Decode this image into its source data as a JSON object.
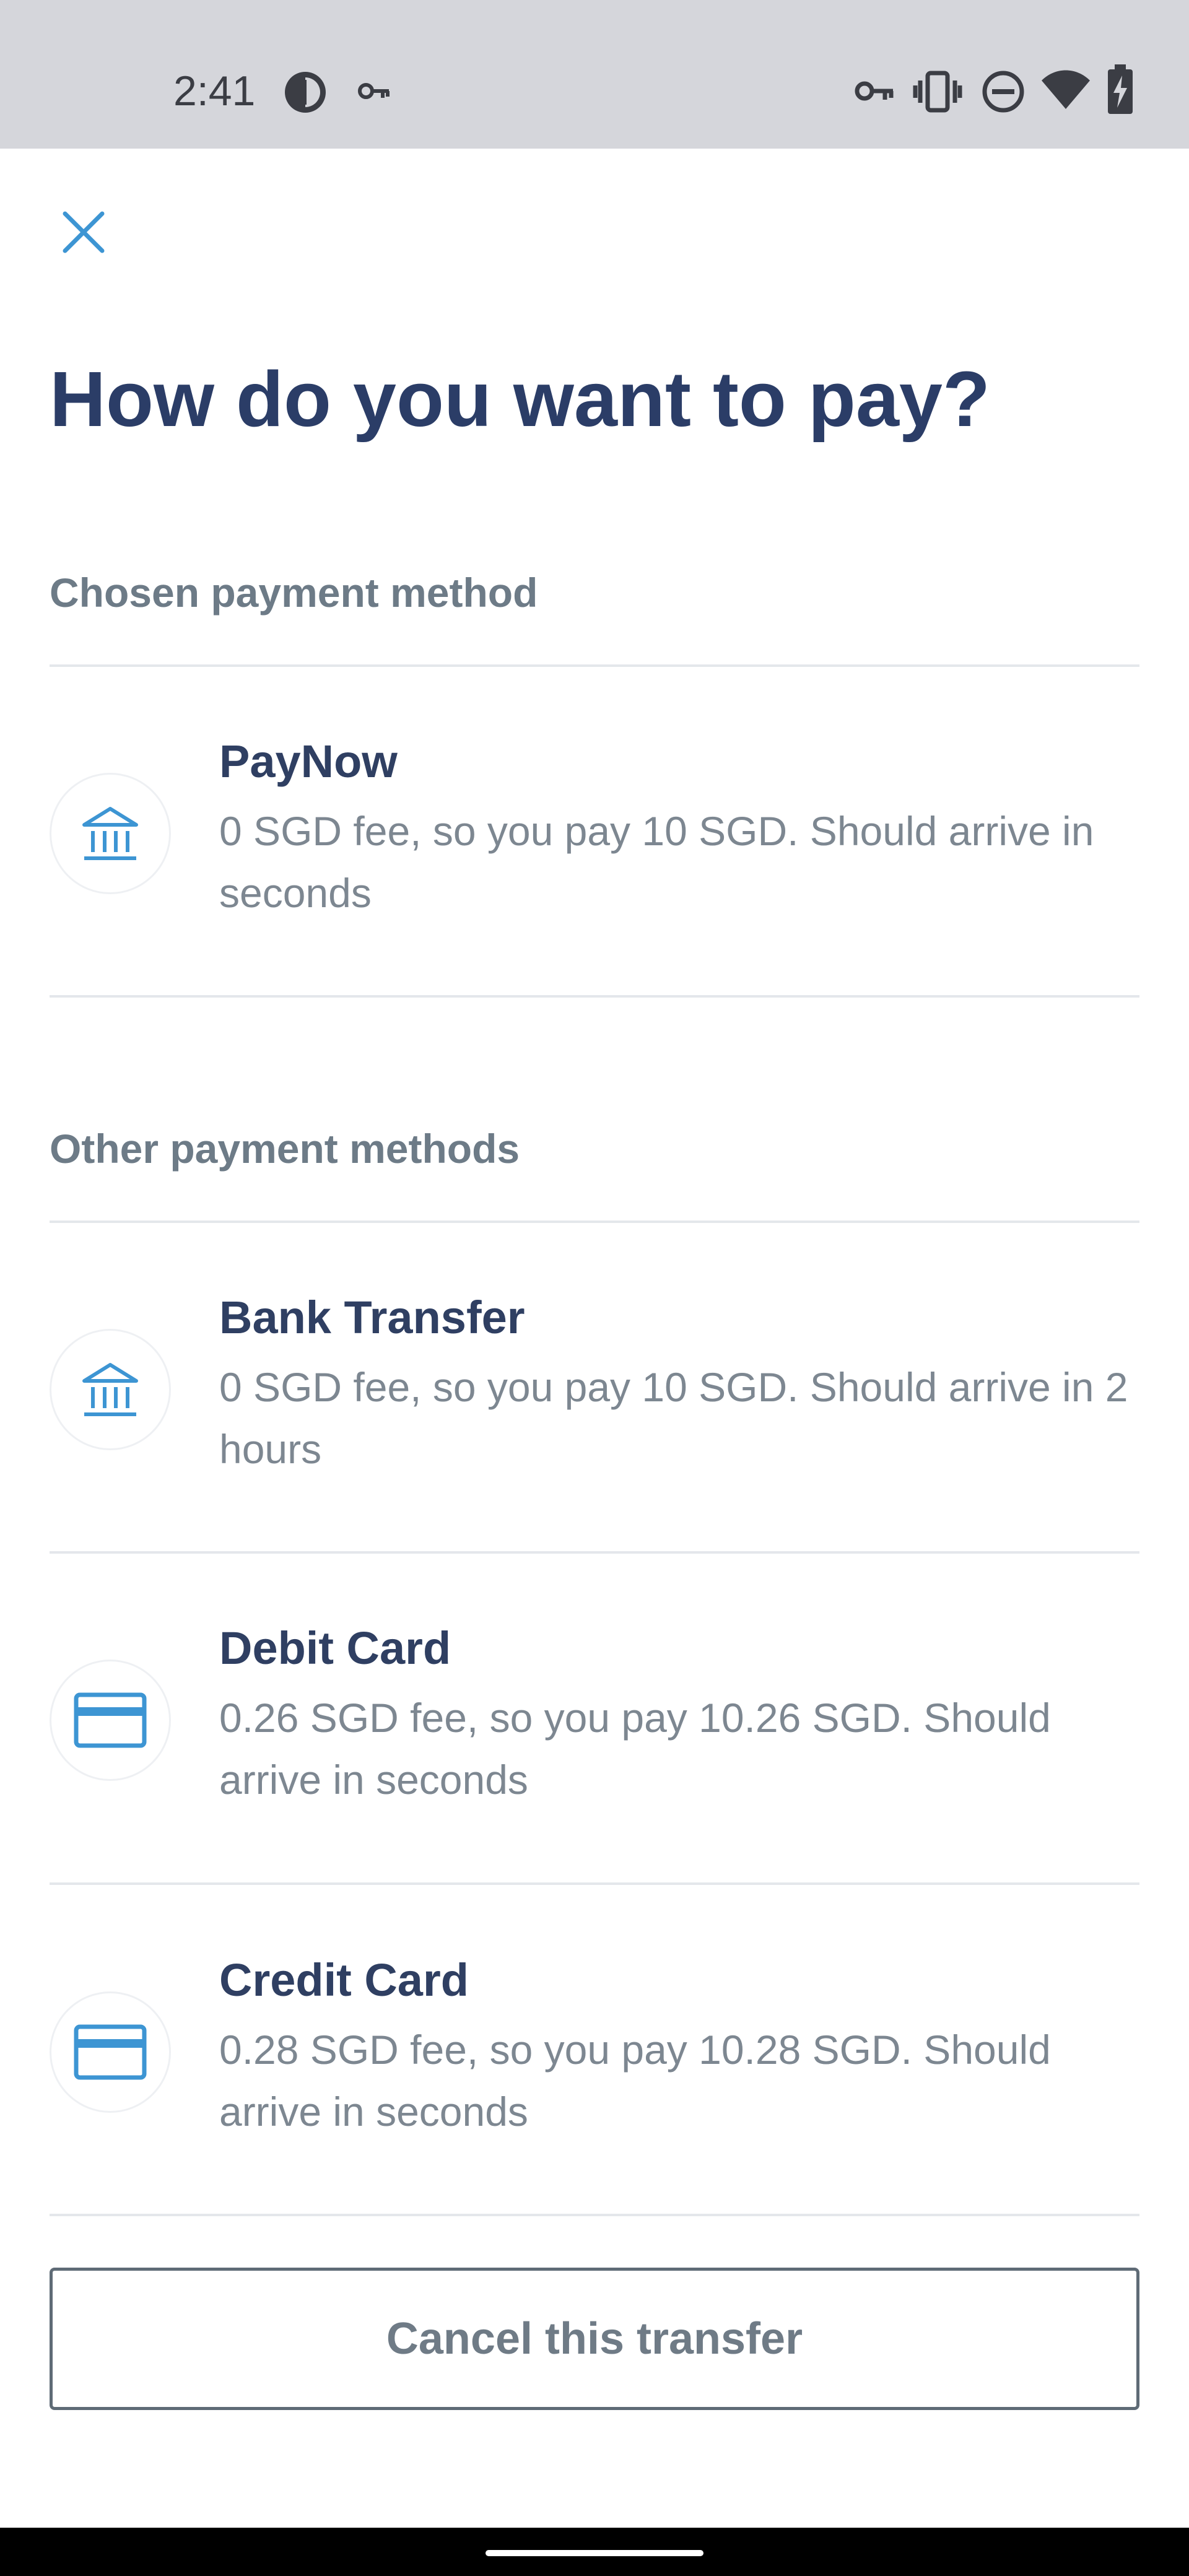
{
  "status_bar": {
    "time": "2:41",
    "left_icons": [
      "app-notification-icon",
      "vpn-key-icon"
    ],
    "right_icons": [
      "vpn-key-icon",
      "vibrate-icon",
      "do-not-disturb-icon",
      "wifi-icon",
      "battery-charging-icon"
    ]
  },
  "header": {
    "close_icon": "close-icon",
    "title": "How do you want to pay?"
  },
  "chosen_section": {
    "label": "Chosen payment method",
    "method": {
      "icon": "bank-icon",
      "title": "PayNow",
      "description": "0 SGD fee, so you pay 10 SGD. Should arrive in seconds"
    }
  },
  "other_section": {
    "label": "Other payment methods",
    "methods": [
      {
        "icon": "bank-icon",
        "title": "Bank Transfer",
        "description": "0 SGD fee, so you pay 10 SGD. Should arrive in 2 hours"
      },
      {
        "icon": "card-icon",
        "title": "Debit Card",
        "description": "0.26 SGD fee, so you pay 10.26 SGD. Should arrive in seconds"
      },
      {
        "icon": "card-icon",
        "title": "Credit Card",
        "description": "0.28 SGD fee, so you pay 10.28 SGD. Should arrive in seconds"
      }
    ]
  },
  "actions": {
    "cancel_label": "Cancel this transfer"
  },
  "colors": {
    "accent": "#3d95d3",
    "title": "#2b3d67",
    "muted": "#6d7b87",
    "status_bar": "#d5d6db"
  }
}
